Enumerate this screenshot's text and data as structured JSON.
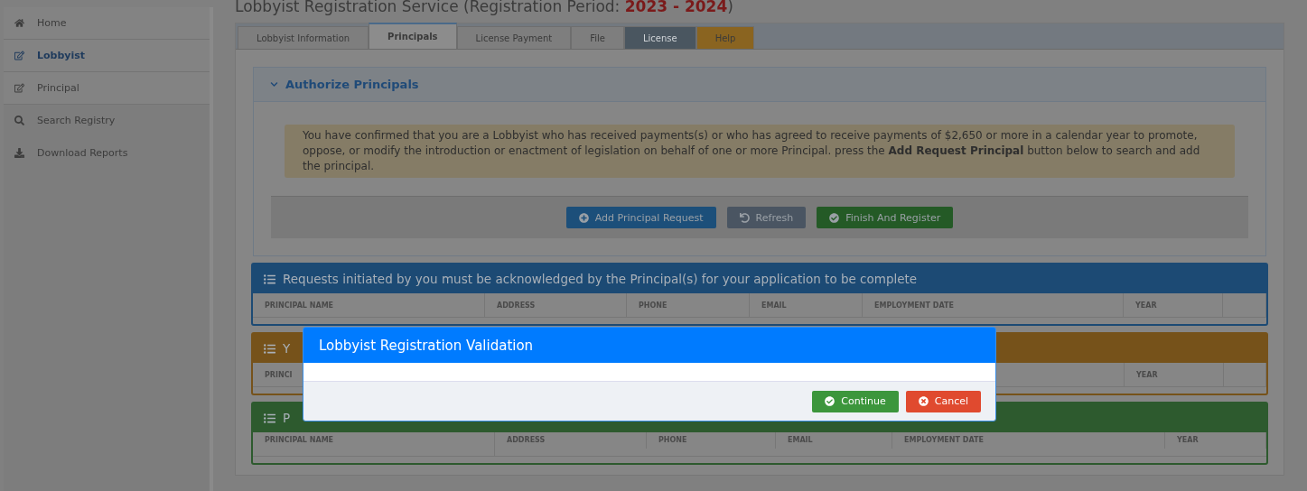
{
  "header": {
    "title": "Lobbyist Registration Service (Registration Period: ",
    "period": "2023 - 2024",
    "closing": ")"
  },
  "sidebar": {
    "items": [
      {
        "label": "Home",
        "kind": "home",
        "selected": false
      },
      {
        "label": "Lobbyist",
        "kind": "edit",
        "selected": true
      },
      {
        "label": "Principal",
        "kind": "edit",
        "selected": false
      },
      {
        "label": "Search Registry",
        "kind": "search",
        "selected": false
      },
      {
        "label": "Download Reports",
        "kind": "download",
        "selected": false
      }
    ]
  },
  "tabs": [
    {
      "label": "Lobbyist Information",
      "selected": false,
      "kind": "plain"
    },
    {
      "label": "Principals",
      "selected": true,
      "kind": "plain"
    },
    {
      "label": "License Payment",
      "selected": false,
      "kind": "plain"
    },
    {
      "label": "File",
      "selected": false,
      "kind": "plain"
    },
    {
      "label": "License",
      "selected": false,
      "kind": "dark"
    },
    {
      "label": "Help",
      "selected": false,
      "kind": "warning"
    }
  ],
  "authorize": {
    "title": "Authorize Principals",
    "expanded": true,
    "notice": "You have confirmed that you are a Lobbyist who has received payments(s) or who has agreed to receive payments of $2,650 or more in a calendar year to promote, oppose, or modify the introduction or enactment of legislation on behalf of one or more Principal. press the **Add Request Principal** button below to search and add the principal.",
    "buttons": [
      {
        "label": "Add Principal Request",
        "kind": "primary"
      },
      {
        "label": "Refresh",
        "kind": "secondary"
      },
      {
        "label": "Finish And Register",
        "kind": "success"
      }
    ]
  },
  "panels": [
    {
      "title": "Requests initiated by you must be acknowledged by the Principal(s) for your application to be complete",
      "color": "#1c4a74",
      "columns": [
        "PRINCIPAL NAME",
        "ADDRESS",
        "PHONE",
        "EMAIL",
        "EMPLOYMENT DATE",
        "YEAR"
      ]
    },
    {
      "title": "Y",
      "color": "#76521a",
      "columns": [
        "PRINCI",
        "YEAR"
      ]
    },
    {
      "title": "P",
      "color": "#2d5a2e",
      "columns": [
        "PRINCIPAL NAME",
        "ADDRESS",
        "PHONE",
        "EMAIL",
        "EMPLOYMENT DATE",
        "YEAR"
      ]
    }
  ],
  "modal": {
    "title": "Lobbyist Registration Validation",
    "buttons": [
      {
        "label": "Continue",
        "kind": "success"
      },
      {
        "label": "Cancel",
        "kind": "danger"
      }
    ]
  }
}
